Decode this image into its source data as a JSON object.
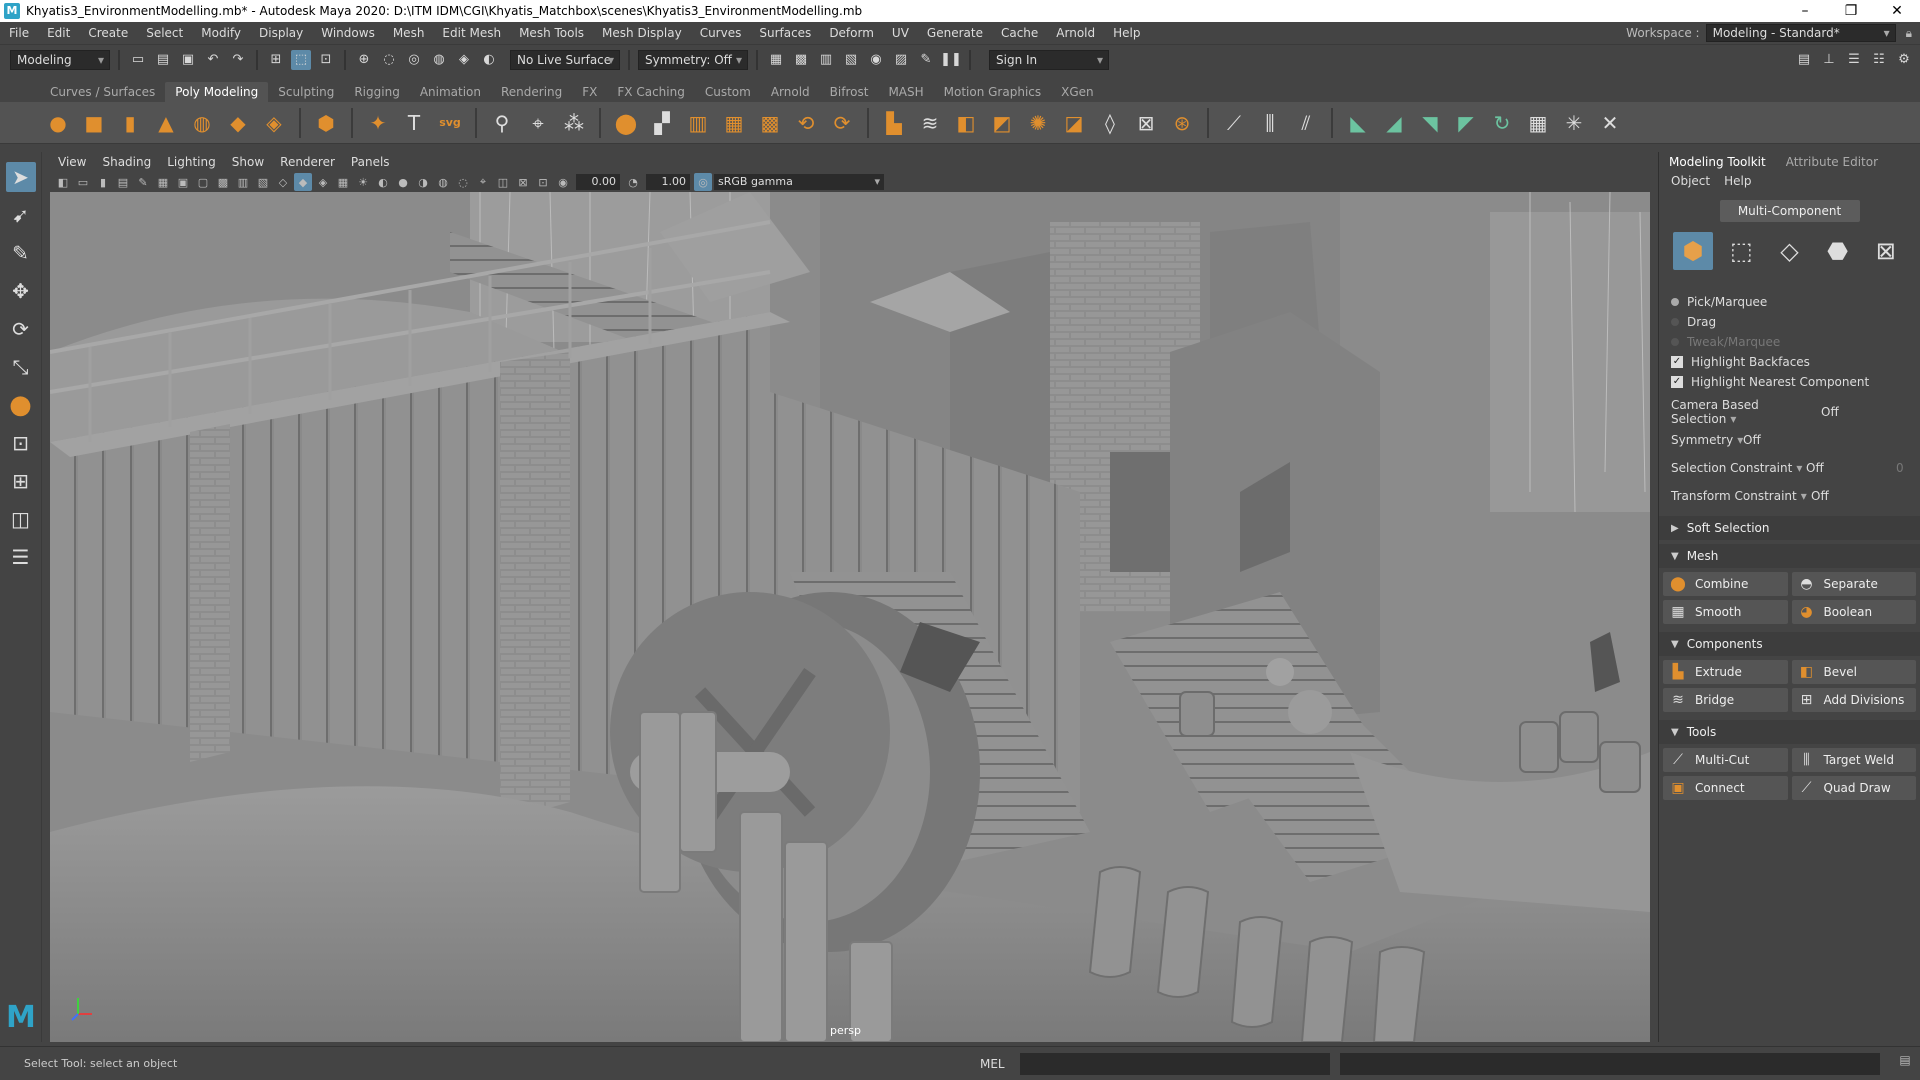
{
  "window": {
    "title": "Khyatis3_EnvironmentModelling.mb* - Autodesk Maya 2020: D:\\ITM IDM\\CGI\\Khyatis_Matchbox\\scenes\\Khyatis3_EnvironmentModelling.mb",
    "app_icon": "M"
  },
  "menubar": {
    "items": [
      "File",
      "Edit",
      "Create",
      "Select",
      "Modify",
      "Display",
      "Windows",
      "Mesh",
      "Edit Mesh",
      "Mesh Tools",
      "Mesh Display",
      "Curves",
      "Surfaces",
      "Deform",
      "UV",
      "Generate",
      "Cache",
      "Arnold",
      "Help"
    ],
    "workspace_label": "Workspace :",
    "workspace_value": "Modeling - Standard*"
  },
  "statusline": {
    "menuset": "Modeling",
    "live_surface": "No Live Surface",
    "symmetry": "Symmetry: Off",
    "sign_in": "Sign In"
  },
  "shelf": {
    "tabs": [
      "Curves / Surfaces",
      "Poly Modeling",
      "Sculpting",
      "Rigging",
      "Animation",
      "Rendering",
      "FX",
      "FX Caching",
      "Custom",
      "Arnold",
      "Bifrost",
      "MASH",
      "Motion Graphics",
      "XGen"
    ],
    "active_tab": "Poly Modeling",
    "text_icon": "T",
    "svg_icon": "svg"
  },
  "panel": {
    "menus": [
      "View",
      "Shading",
      "Lighting",
      "Show",
      "Renderer",
      "Panels"
    ],
    "exposure": "0.00",
    "gamma": "1.00",
    "color_space": "sRGB gamma",
    "camera_label": "persp"
  },
  "toolkit": {
    "tabs": [
      "Modeling Toolkit",
      "Attribute Editor"
    ],
    "menu": [
      "Object",
      "Help"
    ],
    "multi_component": "Multi-Component",
    "pick_marquee": "Pick/Marquee",
    "drag": "Drag",
    "tweak_marquee": "Tweak/Marquee",
    "highlight_backfaces": "Highlight Backfaces",
    "highlight_nearest": "Highlight Nearest Component",
    "camera_based_selection": {
      "label": "Camera Based Selection",
      "value": "Off"
    },
    "symmetry": {
      "label": "Symmetry",
      "value": "Off"
    },
    "selection_constraint": {
      "label": "Selection Constraint",
      "value": "Off",
      "extra": "0"
    },
    "transform_constraint": {
      "label": "Transform Constraint",
      "value": "Off"
    },
    "soft_selection": "Soft Selection",
    "sections": {
      "mesh": {
        "title": "Mesh",
        "buttons": [
          "Combine",
          "Separate",
          "Smooth",
          "Boolean"
        ]
      },
      "components": {
        "title": "Components",
        "buttons": [
          "Extrude",
          "Bevel",
          "Bridge",
          "Add Divisions"
        ]
      },
      "tools": {
        "title": "Tools",
        "buttons": [
          "Multi-Cut",
          "Target Weld",
          "Connect",
          "Quad Draw"
        ]
      }
    }
  },
  "helpline": {
    "help_text": "Select Tool: select an object",
    "mel": "MEL"
  }
}
